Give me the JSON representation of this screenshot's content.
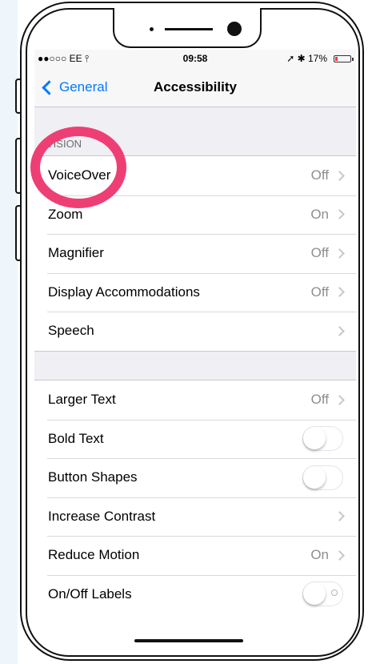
{
  "status_bar": {
    "carrier": "●●○○○ EE",
    "wifi_icon": "wifi-icon",
    "time": "09:58",
    "right_icons": "➚ ✱ 17%",
    "battery_level": 0.17,
    "battery_color": "#ff3b30"
  },
  "nav": {
    "back_label": "General",
    "title": "Accessibility",
    "accent": "#007aff"
  },
  "section1": {
    "header": "VISION",
    "rows": [
      {
        "label": "VoiceOver",
        "value": "Off"
      },
      {
        "label": "Zoom",
        "value": "On"
      },
      {
        "label": "Magnifier",
        "value": "Off"
      },
      {
        "label": "Display Accommodations",
        "value": "Off"
      },
      {
        "label": "Speech",
        "value": ""
      }
    ]
  },
  "section2": {
    "rows": [
      {
        "label": "Larger Text",
        "value": "Off",
        "control": "chevron"
      },
      {
        "label": "Bold Text",
        "control": "toggle",
        "state": "off"
      },
      {
        "label": "Button Shapes",
        "control": "toggle",
        "state": "off"
      },
      {
        "label": "Increase Contrast",
        "value": "",
        "control": "chevron"
      },
      {
        "label": "Reduce Motion",
        "value": "On",
        "control": "chevron"
      },
      {
        "label": "On/Off Labels",
        "control": "toggle",
        "state": "off"
      }
    ]
  },
  "highlight_color": "#ee3f75"
}
